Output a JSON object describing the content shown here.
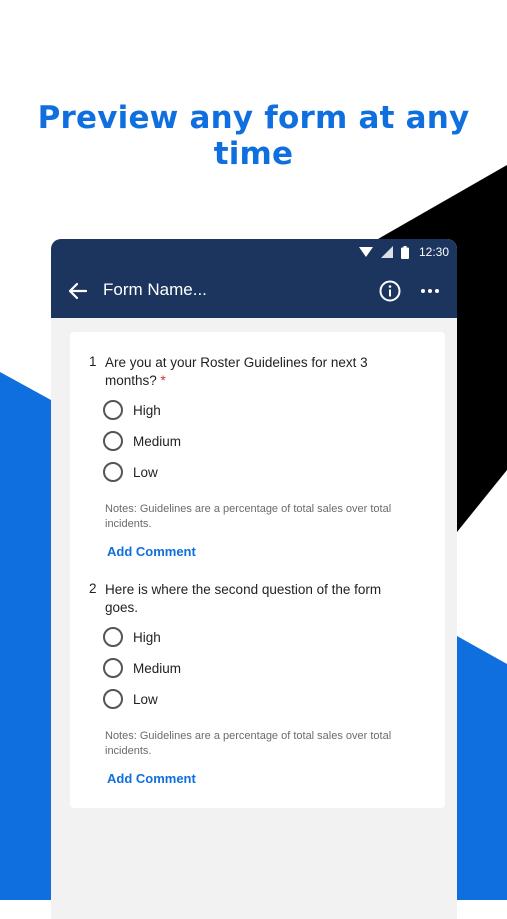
{
  "headline": "Preview any form at any time",
  "colors": {
    "accent_blue": "#0f6fde",
    "header_navy": "#1c355e",
    "required_red": "#d32f2f"
  },
  "status_bar": {
    "time": "12:30",
    "icons": [
      "wifi-icon",
      "signal-icon",
      "battery-icon"
    ]
  },
  "app_bar": {
    "back_icon": "arrow-left-icon",
    "title": "Form Name...",
    "info_icon": "info-icon",
    "more_icon": "more-horizontal-icon"
  },
  "questions": [
    {
      "number": "1",
      "text": "Are you at your Roster Guidelines for next 3 months?",
      "required_marker": "*",
      "options": [
        "High",
        "Medium",
        "Low"
      ],
      "notes": "Notes: Guidelines are a percentage of total sales over total incidents.",
      "add_comment": "Add Comment"
    },
    {
      "number": "2",
      "text": "Here is where the second question of the form goes.",
      "required_marker": "",
      "options": [
        "High",
        "Medium",
        "Low"
      ],
      "notes": "Notes: Guidelines are a percentage of total sales over total incidents.",
      "add_comment": "Add Comment"
    }
  ]
}
